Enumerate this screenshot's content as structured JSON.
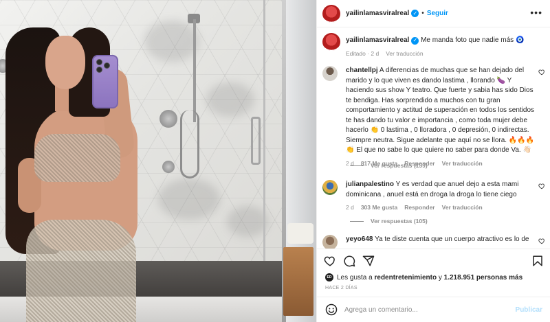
{
  "post": {
    "username": "yailinlamasviralreal",
    "follow_label": "Seguir",
    "more_label": "•••",
    "caption": {
      "username": "yailinlamasviralreal",
      "text": "Me manda foto que nadie más 🧿",
      "edited": "Editado · 2 d",
      "see_translation": "Ver traducción"
    }
  },
  "comments": [
    {
      "username": "chantellpj",
      "text": "A diferencias de muchas que se han dejado del marido y lo que viven es dando lastima , llorando 🍆 Y haciendo sus show Y teatro. Que fuerte y sabia has sido Dios te bendiga. Has sorprendido a muchos con tu gran comportamiento y actitud de superación en todos los sentidos te has dando tu valor e importancia , como toda mujer debe hacerlo 👏 0 lastima , 0 lloradora , 0 depresión, 0 indirectas. Siempre neutra. Sigue adelante que aquí no se llora. 🔥🔥🔥 👏 El que no sabe lo que quiere no saber para donde Va. 👋🏻",
      "age": "2 d",
      "likes": "817 Me gusta",
      "reply": "Responder",
      "translate": "Ver traducción",
      "view_replies": "Ver respuestas (159)"
    },
    {
      "username": "julianpalestino",
      "text": "Y es verdad que anuel dejo a esta mami dominicana , anuel está en droga la droga lo tiene ciego",
      "age": "2 d",
      "likes": "303 Me gusta",
      "reply": "Responder",
      "translate": "Ver traducción",
      "view_replies": "Ver respuestas (105)"
    },
    {
      "username": "yeyo648",
      "text": "Ya te diste cuenta que un cuerpo atractivo es lo de"
    }
  ],
  "likes": {
    "prefix": "Les gusta a",
    "user": "redentretenimiento",
    "and": "y",
    "others": "1.218.951 personas más",
    "badge": "ED"
  },
  "date": "HACE 2 DÍAS",
  "composer": {
    "placeholder": "Agrega un comentario...",
    "post_label": "Publicar"
  }
}
